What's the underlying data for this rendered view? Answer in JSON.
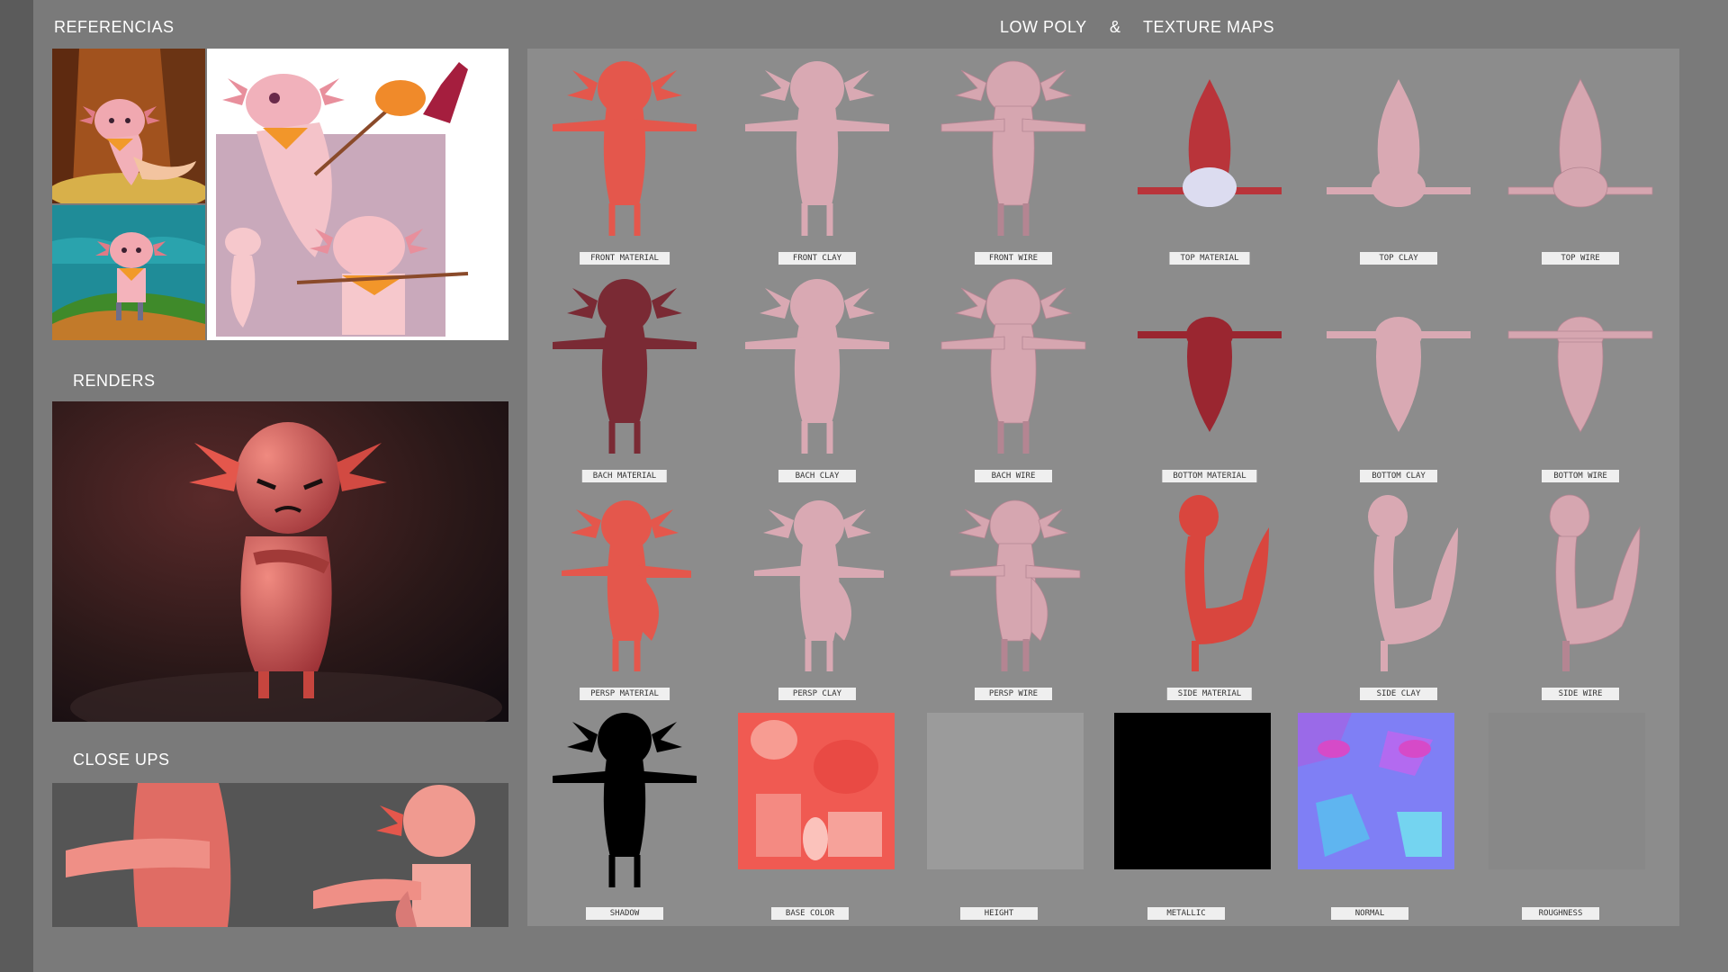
{
  "colors": {
    "background": "#7a7a7a",
    "grid_panel": "#8c8c8c",
    "material": "#e4574c",
    "clay": "#d9a9b3",
    "label_bg": "#efefef"
  },
  "sections": {
    "references": "REFERENCIAS",
    "renders": "RENDERS",
    "close_ups": "CLOSE UPS",
    "low_poly": "LOW POLY",
    "ampersand": "&",
    "texture_maps": "TEXTURE MAPS"
  },
  "grid": {
    "row1": [
      "FRONT MATERIAL",
      "FRONT CLAY",
      "FRONT WIRE",
      "TOP MATERIAL",
      "TOP CLAY",
      "TOP WIRE"
    ],
    "row2": [
      "BACH MATERIAL",
      "BACH CLAY",
      "BACH WIRE",
      "BOTTOM MATERIAL",
      "BOTTOM CLAY",
      "BOTTOM WIRE"
    ],
    "row3": [
      "PERSP MATERIAL",
      "PERSP CLAY",
      "PERSP WIRE",
      "SIDE MATERIAL",
      "SIDE CLAY",
      "SIDE WIRE"
    ],
    "row4": [
      "SHADOW",
      "BASE COLOR",
      "HEIGHT",
      "METALLIC",
      "NORMAL",
      "ROUGHNESS"
    ]
  }
}
